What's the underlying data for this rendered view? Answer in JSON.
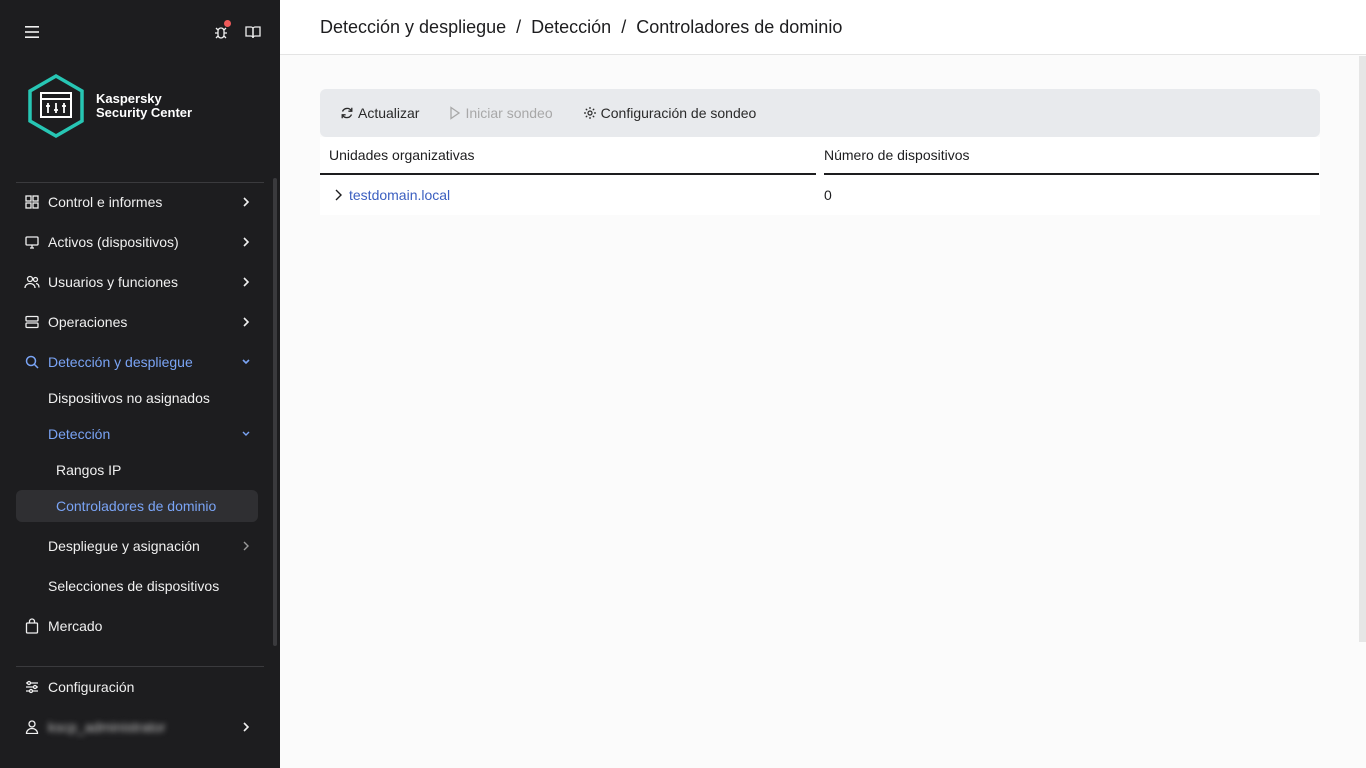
{
  "sidebar": {
    "brand": {
      "line1": "Kaspersky",
      "line2": "Security Center"
    },
    "items": [
      {
        "label": "Control e informes",
        "icon": "dashboard-icon"
      },
      {
        "label": "Activos (dispositivos)",
        "icon": "monitor-icon"
      },
      {
        "label": "Usuarios y funciones",
        "icon": "users-icon"
      },
      {
        "label": "Operaciones",
        "icon": "server-icon"
      },
      {
        "label": "Detección y despliegue",
        "icon": "search-icon"
      },
      {
        "label": "Dispositivos no asignados"
      },
      {
        "label": "Detección"
      },
      {
        "label": "Rangos IP"
      },
      {
        "label": "Controladores de dominio"
      },
      {
        "label": "Despliegue y asignación"
      },
      {
        "label": "Selecciones de dispositivos"
      },
      {
        "label": "Mercado",
        "icon": "shopping-bag-icon"
      }
    ],
    "settings_label": "Configuración",
    "user_label": "kscp_administrator"
  },
  "breadcrumb": [
    "Detección y despliegue",
    "Detección",
    "Controladores de dominio"
  ],
  "toolbar": {
    "refresh": "Actualizar",
    "start_poll": "Iniciar sondeo",
    "poll_config": "Configuración de sondeo"
  },
  "table": {
    "columns": [
      "Unidades organizativas",
      "Número de dispositivos"
    ],
    "rows": [
      {
        "name": "testdomain.local",
        "count": "0"
      }
    ]
  },
  "colors": {
    "sidebar_bg": "#1d1d1f",
    "accent": "#7aa4f5",
    "link": "#3b5fc0",
    "logo_teal": "#27c6b4",
    "notification": "#f05a5a"
  }
}
